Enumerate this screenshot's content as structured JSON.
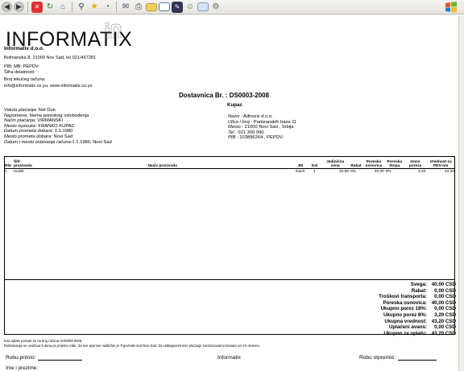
{
  "toolbar": {
    "icons": [
      "back-icon",
      "forward-icon",
      "stop-icon",
      "refresh-icon",
      "home-icon",
      "search-icon",
      "favorites-icon",
      "history-icon",
      "mail-icon",
      "print-icon",
      "folder-icon",
      "window-icon",
      "edit-icon",
      "messenger-icon",
      "research-icon"
    ]
  },
  "logo": {
    "text": "INFORMATIX"
  },
  "company": {
    "name": "Informatix d.o.o.",
    "address": "Bolmanska 8, 21000 Nov Sad, tel 021/467281",
    "pib": "PIB:  MB:   PEPDV:",
    "sifra": "Šifra delatnosti:",
    "racun": "Broj tekućeg računa:",
    "web": "info@informatix.co.yu, www.informatix.co.yu"
  },
  "document": {
    "title": "Dostavnica   Br. : DS0003-2008",
    "kupac_label": "Kupac"
  },
  "meta_left": [
    {
      "label": "Valuta plaćanja:",
      "value": " Net Due"
    },
    {
      "label": "Napomena:",
      "value": " Nema poreskog oslobođenja"
    },
    {
      "label": "Način plaćanja:",
      "value": " VIRMANSKI"
    },
    {
      "label": "Mesto isporuke:",
      "value": " FRANKO KUPAC"
    },
    {
      "label": "Datum prometa dobara:",
      "value": " 1.1.1980"
    },
    {
      "label": "Mesto prometa dobara:",
      "value": " Novi Sad"
    },
    {
      "label": "Datum i mesto izdavanja računa:",
      "value": "1.1.1980, Novi Sad"
    }
  ],
  "meta_right": [
    {
      "label": "Naziv :",
      "value": " Adheziv d.o.o."
    },
    {
      "label": "Ulica i broj :",
      "value": " Partizanskih baza 11"
    },
    {
      "label": "Mesto :",
      "value": " 21000 Novi Sad , Srbija"
    },
    {
      "label": "Tel :",
      "value": " 021 300 990"
    },
    {
      "label": "PIB :",
      "value": " 103896264 , PEPDV:"
    }
  ],
  "table": {
    "headers": [
      "Rbr",
      "Šifr proizvoda",
      "Naziv proizvoda",
      "JM",
      "Kol",
      "Jedinična cena",
      "Rabat",
      "Poreska osnovica",
      "Poreska Stopa",
      "Iznos poreza",
      "Vrednost sa PDV-om"
    ],
    "rows": [
      [
        "1",
        "HLEB",
        "",
        "Each",
        "1",
        "40,00",
        "0%",
        "40,00",
        "8%",
        "3,20",
        "43,20"
      ]
    ]
  },
  "totals": [
    {
      "label": "Svega:",
      "value": "40,00 CSD"
    },
    {
      "label": "Rabat:",
      "value": "0,00 CSD"
    },
    {
      "label": "Troškovi transporta:",
      "value": "0,00 CSD"
    },
    {
      "label": "Poreska osnovica:",
      "value": "40,00 CSD"
    },
    {
      "label": "Ukupno porez 18%:",
      "value": "0,00 CSD"
    },
    {
      "label": "Ukupno porez 8%:",
      "value": "3,20 CSD"
    },
    {
      "label": "Ukupna vrednost:",
      "value": "43,20 CSD"
    },
    {
      "label": "Uplaćeni avans:",
      "value": "0,00 CSD"
    },
    {
      "label": "Ukupno za uplatu:",
      "value": "43,20 CSD"
    }
  ],
  "footer": {
    "note1": "Kod uplate pozvati se na broj računa: DS0003-2008.",
    "note2": "Reklamacija se uvažava 8 dana po prijemu robe. Za sve sporove nadležan je Trgovinski sud Novi Sad. Za neblagovremeno plaćanje zaračunavamo kamatu od 1% dnevno."
  },
  "signatures": {
    "primio": "Robu primio:",
    "firma": "Informatix",
    "otpremio": "Robu otpremio:",
    "ime": "Ime i prezime:"
  },
  "colors": {
    "toolbar_bg": "#ece9d8",
    "text": "#000000"
  }
}
